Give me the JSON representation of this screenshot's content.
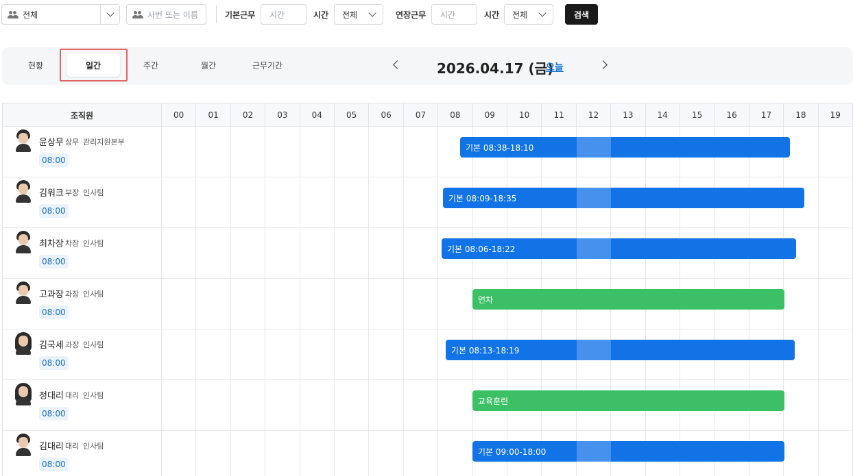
{
  "filters": {
    "org_select": "전체",
    "name_placeholder": "사번 또는 이름",
    "basic_label": "기본근무",
    "basic_time_placeholder": "시간",
    "basic_time_label": "시간",
    "basic_select": "전체",
    "overtime_label": "연장근무",
    "overtime_time_placeholder": "시간",
    "overtime_time_label": "시간",
    "overtime_select": "전체",
    "search_button": "검색"
  },
  "tabs": [
    {
      "label": "현황"
    },
    {
      "label": "일간",
      "active": true
    },
    {
      "label": "주간"
    },
    {
      "label": "월간"
    },
    {
      "label": "근무기간"
    }
  ],
  "date_nav": {
    "date": "2026.04.17 (금)",
    "today_link": "오늘"
  },
  "table": {
    "member_header": "조직원",
    "hours": [
      "00",
      "01",
      "02",
      "03",
      "04",
      "05",
      "06",
      "07",
      "08",
      "09",
      "10",
      "11",
      "12",
      "13",
      "14",
      "15",
      "16",
      "17",
      "18",
      "19"
    ]
  },
  "members": [
    {
      "name": "윤상무",
      "rank": "상무",
      "dept": "관리지원본부",
      "time": "08:00",
      "avatar": "male",
      "bar": {
        "type": "blue",
        "label": "기본 08:38-18:10"
      }
    },
    {
      "name": "김워크",
      "rank": "부장",
      "dept": "인사팀",
      "time": "08:00",
      "avatar": "male",
      "bar": {
        "type": "blue",
        "label": "기본 08:09-18:35"
      }
    },
    {
      "name": "최차장",
      "rank": "차장",
      "dept": "인사팀",
      "time": "08:00",
      "avatar": "male",
      "bar": {
        "type": "blue",
        "label": "기본 08:06-18:22"
      }
    },
    {
      "name": "고과장",
      "rank": "과장",
      "dept": "인사팀",
      "time": "08:00",
      "avatar": "male",
      "bar": {
        "type": "green",
        "label": "연차"
      }
    },
    {
      "name": "김국세",
      "rank": "과장",
      "dept": "인사팀",
      "time": "08:00",
      "avatar": "female",
      "bar": {
        "type": "blue",
        "label": "기본 08:13-18:19"
      }
    },
    {
      "name": "정대리",
      "rank": "대리",
      "dept": "인사팀",
      "time": "08:00",
      "avatar": "female",
      "bar": {
        "type": "green",
        "label": "교육훈련"
      }
    },
    {
      "name": "김대리",
      "rank": "대리",
      "dept": "인사팀",
      "time": "08:00",
      "avatar": "male",
      "bar": {
        "type": "blue",
        "label": "기본 09:00-18:00"
      }
    }
  ],
  "colors": {
    "accent_blue": "#1273e6",
    "leave_green": "#3cc066",
    "link_blue": "#1976d2",
    "highlight_red": "#e06666"
  }
}
